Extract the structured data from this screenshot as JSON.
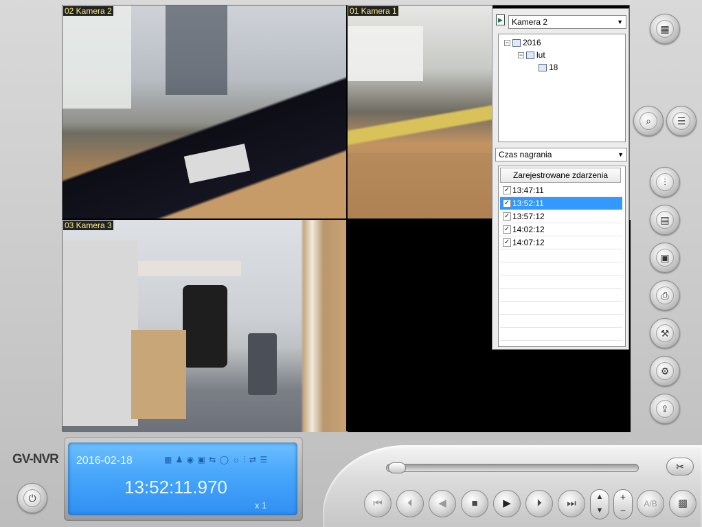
{
  "cameras": [
    {
      "label": "02 Kamera 2"
    },
    {
      "label": "01 Kamera 1"
    },
    {
      "label": "03 Kamera 3"
    }
  ],
  "panel": {
    "camera_select": "Kamera 2",
    "tree": {
      "year": "2016",
      "month": "lut",
      "day": "18"
    },
    "mode_select": "Czas nagrania",
    "events_header": "Zarejestrowane zdarzenia",
    "events": [
      {
        "time": "13:47:11",
        "checked": true,
        "selected": false
      },
      {
        "time": "13:52:11",
        "checked": true,
        "selected": true
      },
      {
        "time": "13:57:12",
        "checked": true,
        "selected": false
      },
      {
        "time": "14:02:12",
        "checked": true,
        "selected": false
      },
      {
        "time": "14:07:12",
        "checked": true,
        "selected": false
      }
    ]
  },
  "brand": "GV-NVR",
  "lcd": {
    "date": "2016-02-18",
    "time": "13:52:11.970",
    "speed": "x 1"
  },
  "playback": {
    "position": 0.0
  },
  "colors": {
    "lcd_blue": "#4aa8fb",
    "selection": "#3399ff",
    "camera_label": "#f7f07a"
  },
  "icons": {
    "layout": "layout-icon",
    "search": "search-icon",
    "list": "list-icon",
    "settings_sliders": "sliders-icon",
    "save_avi": "save-avi-icon",
    "save_bmp": "save-bmp-icon",
    "print": "print-icon",
    "tools": "tools-icon",
    "config": "gear-wrench-icon",
    "export": "export-icon"
  }
}
